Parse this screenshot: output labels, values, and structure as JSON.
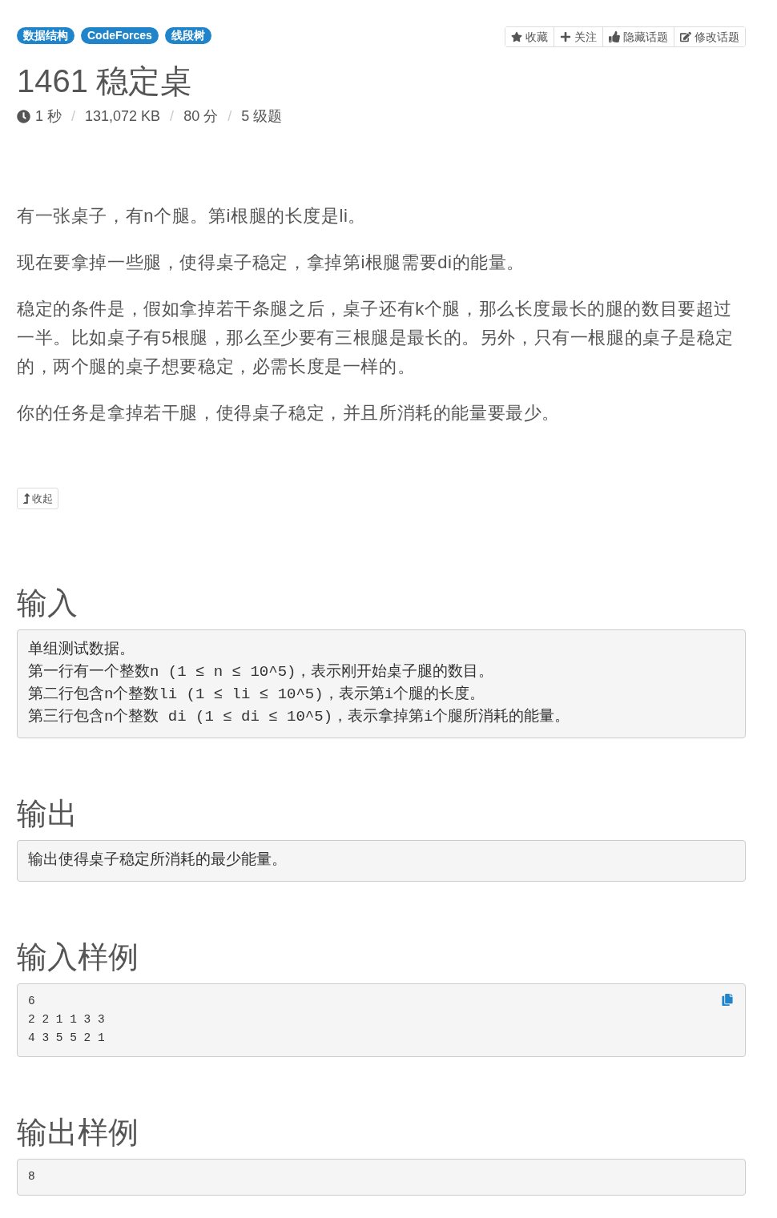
{
  "tags": [
    {
      "label": "数据结构"
    },
    {
      "label": "CodeForces"
    },
    {
      "label": "线段树"
    }
  ],
  "toolbar": [
    {
      "label": "收藏"
    },
    {
      "label": "关注"
    },
    {
      "label": "隐藏话题"
    },
    {
      "label": "修改话题"
    }
  ],
  "title": {
    "number": "1461",
    "name": "稳定桌"
  },
  "meta": [
    {
      "kind": "value",
      "text": "1 秒"
    },
    {
      "kind": "separator",
      "text": "/"
    },
    {
      "kind": "value",
      "text": "131,072 KB"
    },
    {
      "kind": "separator",
      "text": "/"
    },
    {
      "kind": "value",
      "text": "80 分"
    },
    {
      "kind": "separator",
      "text": "/"
    },
    {
      "kind": "value",
      "text": "5 级题"
    }
  ],
  "description": [
    "有一张桌子，有n个腿。第i根腿的长度是li。",
    "现在要拿掉一些腿，使得桌子稳定，拿掉第i根腿需要di的能量。",
    "稳定的条件是，假如拿掉若干条腿之后，桌子还有k个腿，那么长度最长的腿的数目要超过一半。比如桌子有5根腿，那么至少要有三根腿是最长的。另外，只有一根腿的桌子是稳定的，两个腿的桌子想要稳定，必需长度是一样的。",
    "你的任务是拿掉若干腿，使得桌子稳定，并且所消耗的能量要最少。"
  ],
  "collapse_button": {
    "label": "收起"
  },
  "sections": [
    {
      "heading": "输入",
      "kind": "text",
      "copyable": false,
      "lines": [
        "单组测试数据。",
        "第一行有一个整数n (1 ≤ n ≤ 10^5)，表示刚开始桌子腿的数目。",
        "第二行包含n个整数li (1 ≤ li ≤ 10^5)，表示第i个腿的长度。",
        "第三行包含n个整数 di (1 ≤ di ≤ 10^5)，表示拿掉第i个腿所消耗的能量。"
      ]
    },
    {
      "heading": "输出",
      "kind": "text",
      "copyable": false,
      "lines": [
        "输出使得桌子稳定所消耗的最少能量。"
      ]
    },
    {
      "heading": "输入样例",
      "kind": "sample",
      "copyable": true,
      "lines": [
        "6",
        "2 2 1 1 3 3",
        "4 3 5 5 2 1"
      ]
    },
    {
      "heading": "输出样例",
      "kind": "sample",
      "copyable": false,
      "lines": [
        "8"
      ]
    }
  ]
}
